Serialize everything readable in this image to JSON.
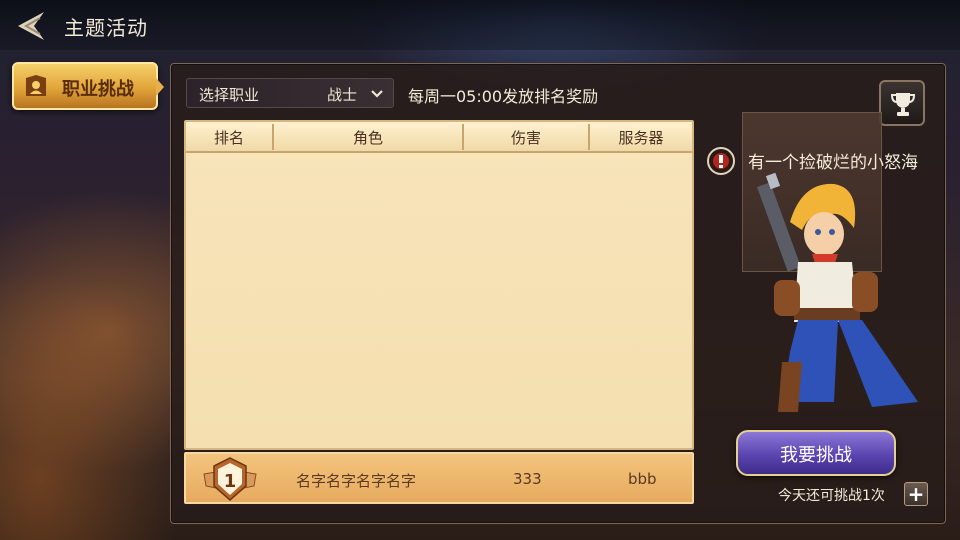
{
  "header": {
    "title": "主题活动"
  },
  "sidebar": {
    "tabs": [
      {
        "label": "职业挑战",
        "selected": true
      }
    ]
  },
  "filter": {
    "label": "选择职业",
    "value": "战士"
  },
  "reward_note": "每周一05:00发放排名奖励",
  "table": {
    "columns": [
      "排名",
      "角色",
      "伤害",
      "服务器"
    ],
    "rows": []
  },
  "my_row": {
    "rank": "1",
    "name": "名字名字名字名字",
    "damage": "333",
    "server": "bbb"
  },
  "npc": {
    "line": "有一个捡破烂的小怒海"
  },
  "challenge": {
    "button_label": "我要挑战",
    "remaining_text": "今天还可挑战1次"
  },
  "icons": [
    "back-icon",
    "tab-icon",
    "chevron-down-icon",
    "trophy-icon",
    "rank-medal-icon",
    "chat-icon",
    "plus-icon"
  ],
  "colors": {
    "accent_gold": "#e1a53a",
    "challenge_purple": "#5b45b0",
    "table_bg": "#f5dfb0"
  }
}
